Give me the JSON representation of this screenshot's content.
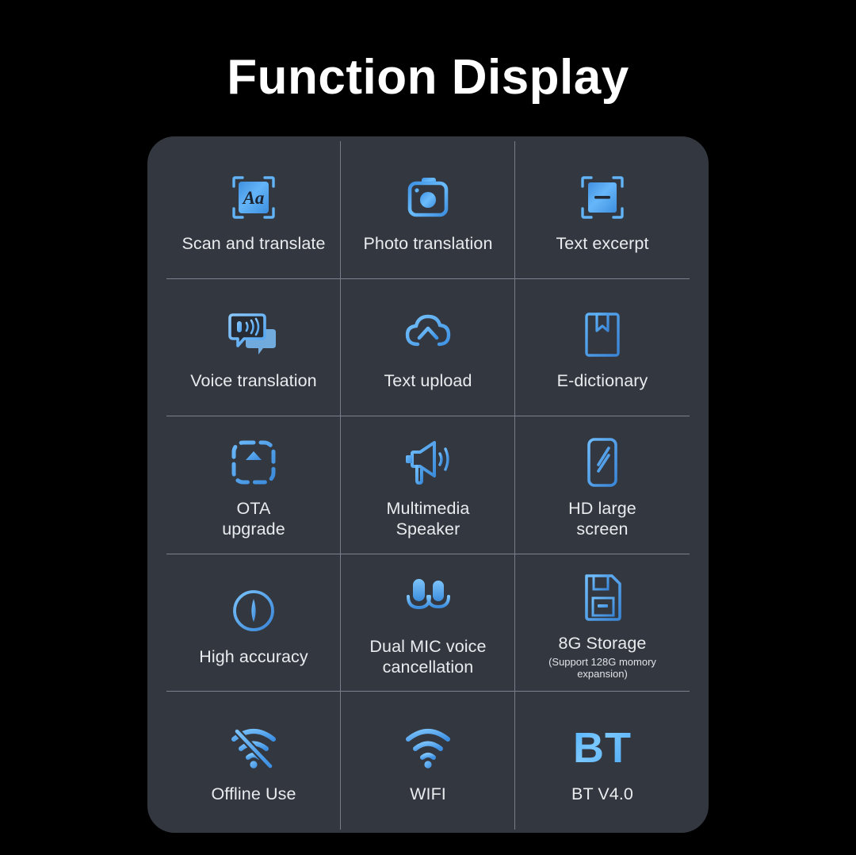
{
  "page": {
    "title": "Function Display",
    "background_color": "#000000",
    "card_color": "#33373f",
    "accent_color": "#4ea6f5",
    "text_color": "#e9ecef",
    "divider_color": "#7b828e"
  },
  "features": [
    {
      "id": "scan-and-translate",
      "icon": "scan-text-aa-icon",
      "label": "Scan and translate",
      "sublabel": ""
    },
    {
      "id": "photo-translation",
      "icon": "camera-icon",
      "label": "Photo translation",
      "sublabel": ""
    },
    {
      "id": "text-excerpt",
      "icon": "text-excerpt-scan-icon",
      "label": "Text excerpt",
      "sublabel": ""
    },
    {
      "id": "voice-translation",
      "icon": "speech-bubble-sound-icon",
      "label": "Voice translation",
      "sublabel": ""
    },
    {
      "id": "text-upload",
      "icon": "cloud-upload-icon",
      "label": "Text upload",
      "sublabel": ""
    },
    {
      "id": "e-dictionary",
      "icon": "book-bookmark-icon",
      "label": "E-dictionary",
      "sublabel": ""
    },
    {
      "id": "ota-upgrade",
      "icon": "ota-upload-dashed-icon",
      "label": "OTA\nupgrade",
      "sublabel": ""
    },
    {
      "id": "multimedia-speaker",
      "icon": "megaphone-icon",
      "label": "Multimedia\nSpeaker",
      "sublabel": ""
    },
    {
      "id": "hd-large-screen",
      "icon": "phone-screen-icon",
      "label": "HD large\nscreen",
      "sublabel": ""
    },
    {
      "id": "high-accuracy",
      "icon": "crosshair-target-icon",
      "label": "High accuracy",
      "sublabel": ""
    },
    {
      "id": "dual-mic-voice-cancellation",
      "icon": "dual-microphone-icon",
      "label": "Dual MIC voice\ncancellation",
      "sublabel": ""
    },
    {
      "id": "storage",
      "icon": "memory-card-icon",
      "label": "8G Storage",
      "sublabel": "(Support 128G momory\nexpansion)"
    },
    {
      "id": "offline-use",
      "icon": "wifi-off-icon",
      "label": "Offline Use",
      "sublabel": ""
    },
    {
      "id": "wifi",
      "icon": "wifi-icon",
      "label": "WIFI",
      "sublabel": ""
    },
    {
      "id": "bluetooth",
      "icon": "bt-text-icon",
      "icon_text": "BT",
      "label": "BT V4.0",
      "sublabel": ""
    }
  ]
}
